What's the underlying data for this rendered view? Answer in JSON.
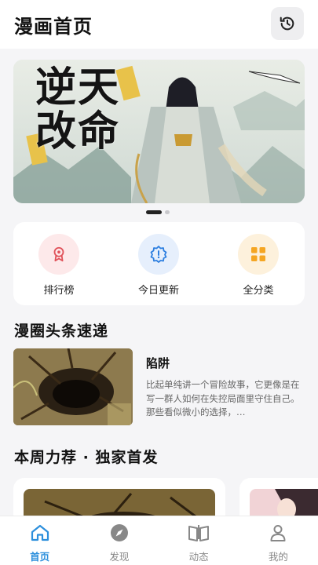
{
  "header": {
    "title": "漫画首页",
    "history_icon": "history-icon"
  },
  "banner": {
    "title_line1": "逆天",
    "title_line2": "改命",
    "slides": 2,
    "active_slide": 1
  },
  "quick_links": [
    {
      "label": "排行榜",
      "icon": "ribbon-badge-icon",
      "color": "#e0525a",
      "bg": "#fde9ea"
    },
    {
      "label": "今日更新",
      "icon": "clock-badge-icon",
      "color": "#2d7fe0",
      "bg": "#e6effc"
    },
    {
      "label": "全分类",
      "icon": "grid-icon",
      "color": "#f5a623",
      "bg": "#fdf1dc"
    }
  ],
  "news_section": {
    "title": "漫圈头条速递",
    "item": {
      "title": "陷阱",
      "description": "比起单纯讲一个冒险故事，它更像是在写一群人如何在失控局面里守住自己。那些看似微小的选择，…"
    }
  },
  "recommend_section": {
    "title": "本周力荐 · 独家首发"
  },
  "tabbar": {
    "items": [
      {
        "label": "首页",
        "icon": "home-icon",
        "active": true
      },
      {
        "label": "发现",
        "icon": "compass-icon",
        "active": false
      },
      {
        "label": "动态",
        "icon": "open-book-icon",
        "active": false
      },
      {
        "label": "我的",
        "icon": "user-icon",
        "active": false
      }
    ],
    "active_color": "#2c8fdc",
    "inactive_color": "#888888"
  }
}
